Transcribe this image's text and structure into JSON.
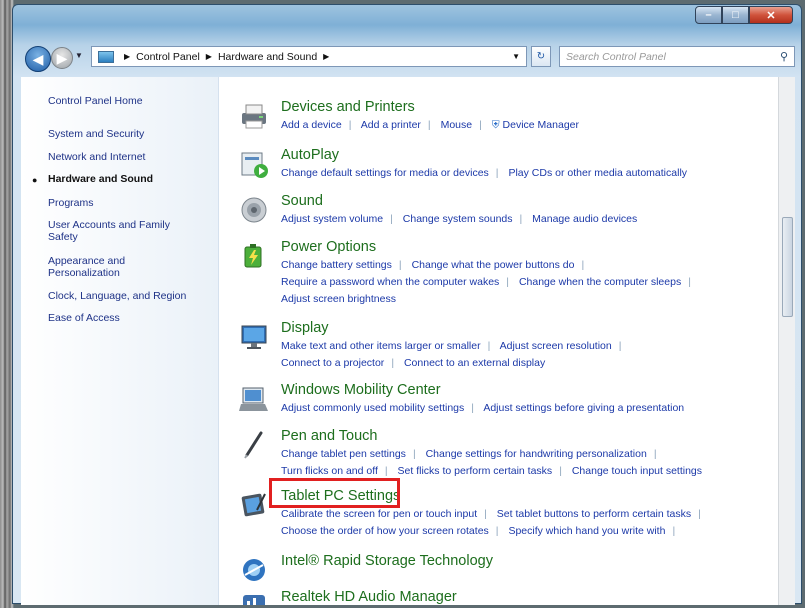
{
  "window": {
    "minimize": "–",
    "maximize": "□",
    "close": "✕"
  },
  "navigation": {
    "breadcrumb": [
      "Control Panel",
      "Hardware and Sound"
    ],
    "search_placeholder": "Search Control Panel"
  },
  "sidebar": {
    "items": [
      {
        "label": "Control Panel Home"
      },
      {
        "label": "System and Security"
      },
      {
        "label": "Network and Internet"
      },
      {
        "label": "Hardware and Sound",
        "active": true
      },
      {
        "label": "Programs"
      },
      {
        "label": "User Accounts and Family Safety"
      },
      {
        "label": "Appearance and Personalization"
      },
      {
        "label": "Clock, Language, and Region"
      },
      {
        "label": "Ease of Access"
      }
    ]
  },
  "main": {
    "categories": [
      {
        "title": "Devices and Printers",
        "icon": "printer-icon",
        "links": [
          [
            "Add a device",
            "Add a printer",
            "Mouse",
            "Device Manager"
          ]
        ]
      },
      {
        "title": "AutoPlay",
        "icon": "autoplay-icon",
        "links": [
          [
            "Change default settings for media or devices",
            "Play CDs or other media automatically"
          ]
        ]
      },
      {
        "title": "Sound",
        "icon": "speaker-icon",
        "links": [
          [
            "Adjust system volume",
            "Change system sounds",
            "Manage audio devices"
          ]
        ]
      },
      {
        "title": "Power Options",
        "icon": "battery-icon",
        "links": [
          [
            "Change battery settings",
            "Change what the power buttons do"
          ],
          [
            "Require a password when the computer wakes",
            "Change when the computer sleeps"
          ],
          [
            "Adjust screen brightness"
          ]
        ]
      },
      {
        "title": "Display",
        "icon": "monitor-icon",
        "links": [
          [
            "Make text and other items larger or smaller",
            "Adjust screen resolution"
          ],
          [
            "Connect to a projector",
            "Connect to an external display"
          ]
        ]
      },
      {
        "title": "Windows Mobility Center",
        "icon": "mobility-center-icon",
        "links": [
          [
            "Adjust commonly used mobility settings",
            "Adjust settings before giving a presentation"
          ]
        ]
      },
      {
        "title": "Pen and Touch",
        "icon": "pen-icon",
        "links": [
          [
            "Change tablet pen settings",
            "Change settings for handwriting personalization"
          ],
          [
            "Turn flicks on and off",
            "Set flicks to perform certain tasks",
            "Change touch input settings"
          ]
        ]
      },
      {
        "title": "Tablet PC Settings",
        "icon": "tablet-icon",
        "links": [
          [
            "Calibrate the screen for pen or touch input",
            "Set tablet buttons to perform certain tasks"
          ],
          [
            "Choose the order of how your screen rotates",
            "Specify which hand you write with"
          ]
        ]
      },
      {
        "title": "Intel® Rapid Storage Technology",
        "icon": "intel-storage-icon",
        "links": []
      },
      {
        "title": "Realtek HD Audio Manager",
        "icon": "realtek-audio-icon",
        "links": []
      }
    ]
  },
  "colors": {
    "link": "#1c39a8",
    "title_green": "#1d6e1d",
    "highlight": "#e12020"
  }
}
